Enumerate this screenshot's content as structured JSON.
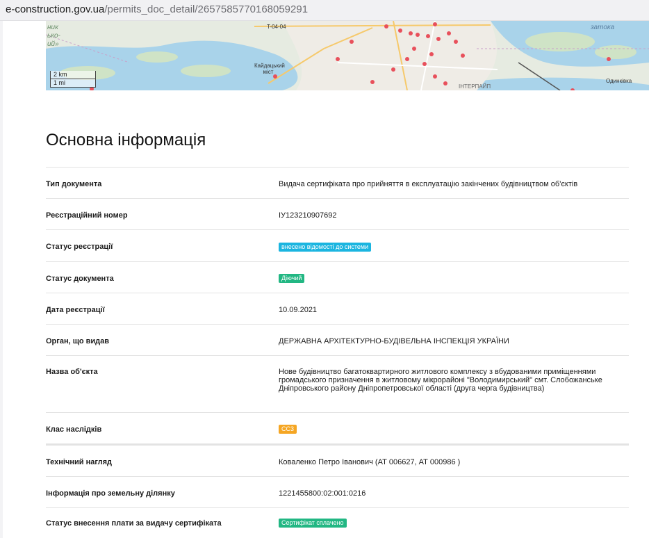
{
  "browser": {
    "url_host": "e-construction.gov.ua",
    "url_path": "/permits_doc_detail/2657585770168059291"
  },
  "map": {
    "labels": {
      "road": "T-04-04",
      "bridge": "Кайдацький міст",
      "bay": "затока",
      "district": "ІНТЕРПАЙП",
      "village": "Одинківка",
      "left_text_1": "ник",
      "left_text_2": "ько-",
      "left_text_3": "ий»"
    },
    "scale_km": "2 km",
    "scale_mi": "1 mi"
  },
  "section": {
    "title": "Основна інформація"
  },
  "rows": [
    {
      "label": "Тип документа",
      "value": "Видача сертифіката про прийняття в експлуатацію закінчених будівництвом об'єктів"
    },
    {
      "label": "Реєстраційний номер",
      "value": "ІУ123210907692"
    },
    {
      "label": "Статус реєстрації",
      "badge": "внесено відомості до системи",
      "badge_color": "#1bb5e0"
    },
    {
      "label": "Статус документа",
      "badge": "Діючий",
      "badge_color": "#22b783"
    },
    {
      "label": "Дата реєстрації",
      "value": "10.09.2021"
    },
    {
      "label": "Орган, що видав",
      "value": "ДЕРЖАВНА АРХІТЕКТУРНО-БУДІВЕЛЬНА ІНСПЕКЦІЯ УКРАЇНИ"
    },
    {
      "label": "Назва об'єкта",
      "value": "Нове будівництво багатоквартирного житлового комплексу з вбудованими приміщеннями громадського призначення в житловому мікрорайоні \"Володимирський\" смт. Слобожанське Дніпровського району Дніпропетровської області (друга черга будівництва)"
    },
    {
      "label": "Клас наслідків",
      "badge": "СС3",
      "badge_color": "#f5a623"
    },
    {
      "label": "Технічний нагляд",
      "value": "Коваленко Петро Іванович (АТ 006627, АТ 000986 )"
    },
    {
      "label": "Інформація про земельну ділянку",
      "value": "1221455800:02:001:0216"
    },
    {
      "label": "Статус внесення плати за видачу сертифіката",
      "badge": "Сертифікат сплачено",
      "badge_color": "#22b783"
    }
  ]
}
